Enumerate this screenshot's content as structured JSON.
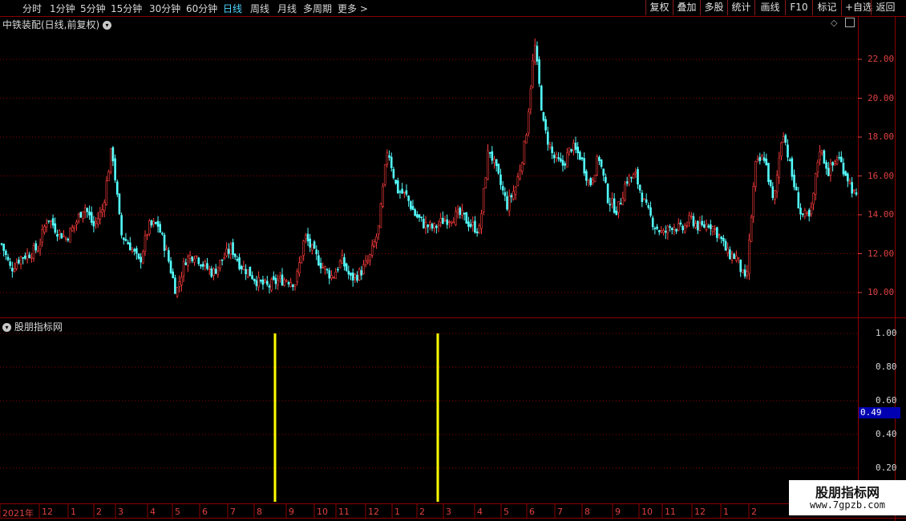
{
  "toolbar": {
    "periods": [
      "分时",
      "1分钟",
      "5分钟",
      "15分钟",
      "30分钟",
      "60分钟",
      "日线",
      "周线",
      "月线",
      "多周期",
      "更多 >"
    ],
    "active_period": "日线",
    "right_buttons": [
      "复权",
      "叠加",
      "多股",
      "统计",
      "画线",
      "F10",
      "标记",
      "+自选",
      "返回"
    ]
  },
  "main_panel": {
    "title": "中铁装配(日线,前复权)",
    "price_labels": [
      "22.00",
      "20.00",
      "18.00",
      "16.00",
      "14.00",
      "12.00",
      "10.00"
    ]
  },
  "indicator_panel": {
    "title": "股朋指标网",
    "labels": [
      "1.00",
      "0.80",
      "0.60",
      "0.40",
      "0.20"
    ],
    "current_value": "0.49"
  },
  "time_axis": [
    "2021年",
    "12",
    "1",
    "2",
    "3",
    "4",
    "5",
    "6",
    "7",
    "8",
    "9",
    "10",
    "11",
    "12",
    "1",
    "2",
    "3",
    "4",
    "5",
    "6",
    "7",
    "8",
    "9",
    "10",
    "11",
    "12",
    "1",
    "2"
  ],
  "watermark": {
    "name": "股朋指标网",
    "url": "www.7gpzb.com"
  },
  "colors": {
    "up": "#ff3c3c",
    "down": "#54ffff",
    "grid": "#8b0000",
    "signal": "#ffff00"
  },
  "chart_data": [
    {
      "type": "candlestick",
      "title": "中铁装配(日线,前复权)",
      "ylim": [
        9.4,
        23.5
      ],
      "close_path": [
        12.5,
        11.2,
        11.8,
        12.0,
        12.3,
        13.9,
        13.2,
        12.8,
        13.5,
        14.5,
        13.4,
        14.3,
        17.5,
        13.0,
        12.4,
        11.5,
        13.4,
        13.5,
        12.0,
        10.0,
        11.7,
        12.0,
        11.4,
        11.0,
        11.7,
        12.3,
        11.4,
        11.0,
        10.5,
        10.3,
        10.6,
        10.7,
        10.5,
        12.9,
        12.0,
        11.3,
        10.8,
        11.7,
        10.7,
        11.0,
        11.7,
        13.2,
        17.5,
        15.3,
        15.0,
        14.0,
        13.5,
        13.3,
        13.7,
        13.9,
        14.0,
        13.5,
        13.2,
        17.5,
        16.0,
        14.5,
        15.5,
        17.8,
        22.8,
        18.5,
        17.0,
        16.5,
        17.5,
        17.0,
        15.5,
        17.0,
        14.8,
        14.2,
        15.8,
        16.0,
        14.5,
        13.5,
        13.0,
        13.5,
        13.2,
        13.8,
        13.3,
        13.6,
        13.0,
        12.0,
        11.8,
        10.4,
        16.5,
        17.0,
        14.5,
        18.5,
        16.0,
        14.0,
        13.8,
        17.5,
        16.2,
        17.0,
        16.0,
        14.8
      ],
      "signals": [
        {
          "x_label": "9",
          "value": 1.0
        },
        {
          "x_label": "3",
          "value": 1.0
        }
      ]
    }
  ]
}
